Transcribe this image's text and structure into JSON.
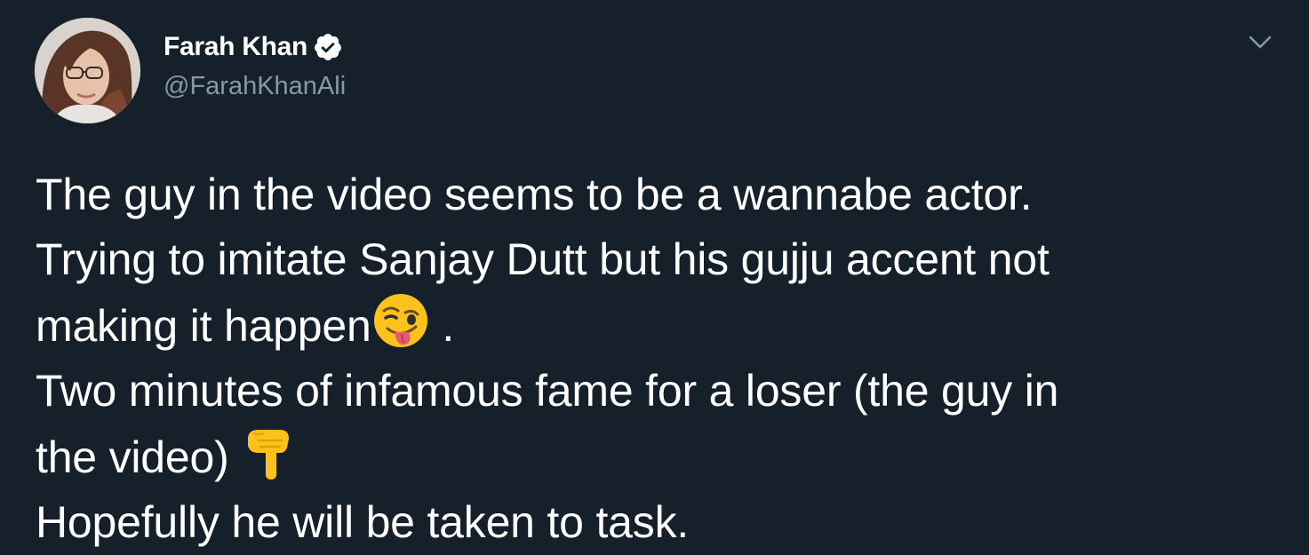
{
  "author": {
    "display_name": "Farah Khan",
    "handle": "@FarahKhanAli",
    "verified": true,
    "verified_icon": "verified-badge-icon"
  },
  "tweet": {
    "lines": [
      "The guy in the video seems to be a wannabe actor.",
      "Trying to imitate Sanjay Dutt but his gujju accent not",
      "making it happen",
      "Two minutes of infamous fame for a loser (the guy in",
      "the video) ",
      "Hopefully he will be taken to task."
    ],
    "line3_suffix": " .",
    "emojis": {
      "wink_tongue": "winking-face-with-tongue-emoji",
      "point_down": "backhand-index-pointing-down-emoji"
    }
  },
  "colors": {
    "background": "#15202b",
    "text": "#ffffff",
    "secondary": "#8899a6"
  }
}
